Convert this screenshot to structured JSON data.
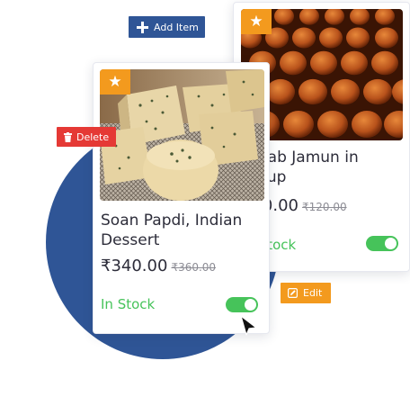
{
  "toolbar": {
    "add_label": "Add Item",
    "delete_label": "Delete",
    "edit_label": "Edit"
  },
  "products": [
    {
      "title": "Gulab Jamun in Syrup",
      "price": "₹80.00",
      "old_price": "₹120.00",
      "stock": "In Stock",
      "in_stock": true,
      "favorite_icon": "star-icon"
    },
    {
      "title": "Soan Papdi, Indian Dessert",
      "price": "₹340.00",
      "old_price": "₹360.00",
      "stock": "In Stock",
      "in_stock": true,
      "favorite_icon": "star-icon"
    }
  ],
  "colors": {
    "primary": "#2f5596",
    "danger": "#e53935",
    "warning": "#f39a1e",
    "success": "#46c35a",
    "text": "#2d2d3a",
    "muted": "#8d8d95"
  },
  "icons": [
    "plus-icon",
    "trash-icon",
    "pencil-icon",
    "star-icon",
    "cursor-icon"
  ]
}
